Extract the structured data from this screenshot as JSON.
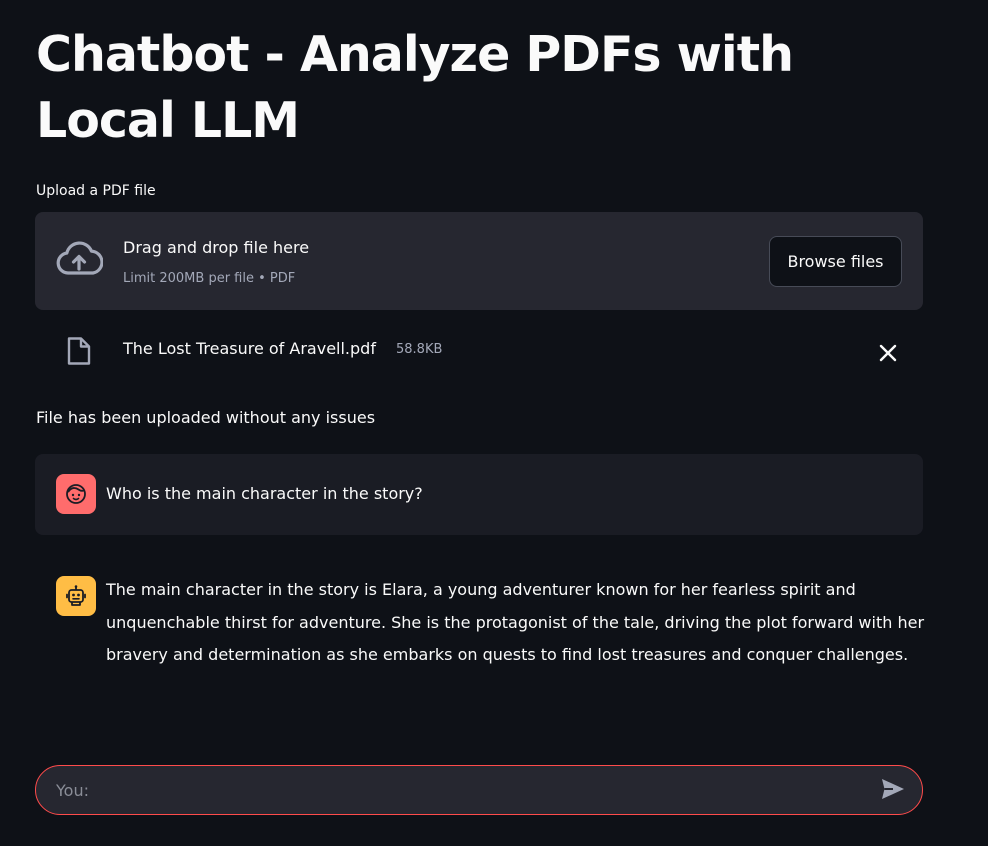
{
  "page": {
    "title": "Chatbot - Analyze PDFs with Local LLM"
  },
  "uploader": {
    "label": "Upload a PDF file",
    "drop_title": "Drag and drop file here",
    "drop_limit": "Limit 200MB per file • PDF",
    "browse_label": "Browse files",
    "icon": "cloud-upload-icon"
  },
  "uploaded_file": {
    "name": "The Lost Treasure of Aravell.pdf",
    "size": "58.8KB",
    "icon": "file-icon",
    "remove_icon": "close-icon"
  },
  "status_message": "File has been uploaded without any issues",
  "chat": {
    "messages": [
      {
        "role": "user",
        "avatar_icon": "user-face-icon",
        "avatar_color": "#ff6c6c",
        "text": "Who is the main character in the story?"
      },
      {
        "role": "assistant",
        "avatar_icon": "robot-icon",
        "avatar_color": "#ffbd45",
        "text": "The main character in the story is Elara, a young adventurer known for her fearless spirit and unquenchable thirst for adventure. She is the protagonist of the tale, driving the plot forward with her bravery and determination as she embarks on quests to find lost treasures and conquer challenges."
      }
    ],
    "input": {
      "placeholder": "You:",
      "value": "",
      "send_icon": "send-icon"
    }
  },
  "colors": {
    "background": "#0e1117",
    "accent": "#ff4b4b",
    "panel": "#262730",
    "user_message_bg": "#1a1c24"
  }
}
